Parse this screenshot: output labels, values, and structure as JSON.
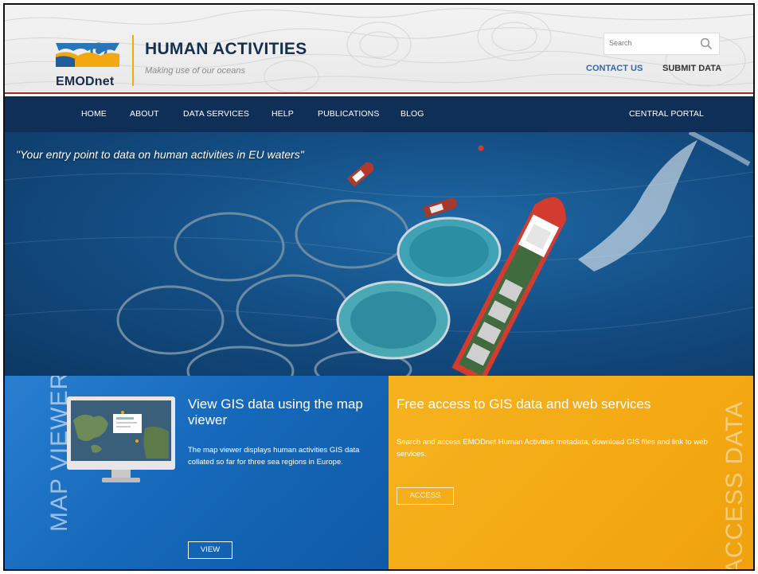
{
  "header": {
    "logo_text": "EMODnet",
    "site_title": "HUMAN ACTIVITIES",
    "tagline": "Making use of our oceans",
    "search_placeholder": "Search",
    "contact_label": "CONTACT US",
    "submit_label": "SUBMIT DATA"
  },
  "nav": {
    "items": [
      "HOME",
      "ABOUT",
      "DATA SERVICES",
      "HELP",
      "PUBLICATIONS",
      "BLOG"
    ],
    "right_item": "CENTRAL PORTAL"
  },
  "hero": {
    "quote": "\"Your entry point to data on human activities in EU waters\""
  },
  "map_viewer_panel": {
    "vertical_label": "MAP VIEWER",
    "title": "View GIS data using the map viewer",
    "text": "The map viewer displays human activities GIS data collated so far for three sea regions in Europe.",
    "button_label": "VIEW"
  },
  "access_panel": {
    "vertical_label": "ACCESS DATA",
    "title": "Free access to GIS data and web services",
    "text": "Search and access EMODnet Human Activities metadata, download GIS files and link to web services.",
    "button_label": "ACCESS"
  },
  "colors": {
    "nav_bg": "#0f2f56",
    "accent_red": "#b5232a",
    "blue_panel": "#1669bb",
    "yellow_panel": "#f3a914",
    "title_dark": "#15304f"
  }
}
